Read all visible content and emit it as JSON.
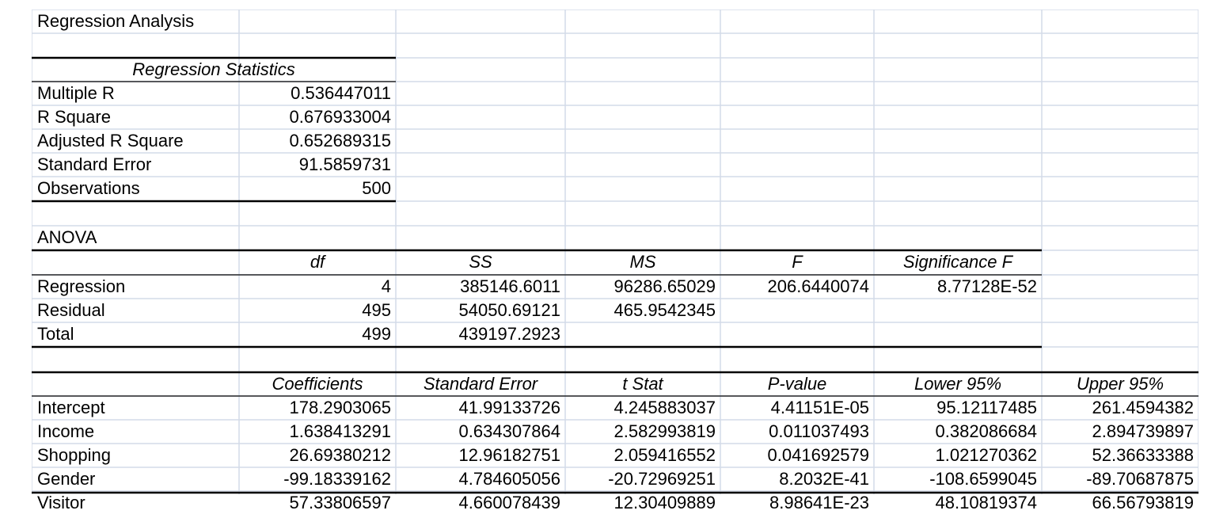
{
  "title": "Regression Analysis",
  "regression_statistics": {
    "header": "Regression Statistics",
    "rows": [
      {
        "label": "Multiple R",
        "value": "0.536447011"
      },
      {
        "label": "R Square",
        "value": "0.676933004"
      },
      {
        "label": "Adjusted R Square",
        "value": "0.652689315"
      },
      {
        "label": "Standard Error",
        "value": "91.5859731"
      },
      {
        "label": "Observations",
        "value": "500"
      }
    ]
  },
  "anova": {
    "title": "ANOVA",
    "headers": [
      "df",
      "SS",
      "MS",
      "F",
      "Significance F"
    ],
    "rows": [
      {
        "label": "Regression",
        "df": "4",
        "ss": "385146.6011",
        "ms": "96286.65029",
        "f": "206.6440074",
        "sig": "8.77128E-52"
      },
      {
        "label": "Residual",
        "df": "495",
        "ss": "54050.69121",
        "ms": "465.9542345"
      },
      {
        "label": "Total",
        "df": "499",
        "ss": "439197.2923"
      }
    ]
  },
  "coefficients": {
    "headers": [
      "Coefficients",
      "Standard Error",
      "t Stat",
      "P-value",
      "Lower 95%",
      "Upper 95%"
    ],
    "rows": [
      {
        "label": "Intercept",
        "coef": "178.2903065",
        "se": "41.99133726",
        "t": "4.245883037",
        "p": "4.41151E-05",
        "lower": "95.12117485",
        "upper": "261.4594382"
      },
      {
        "label": "Income",
        "coef": "1.638413291",
        "se": "0.634307864",
        "t": "2.582993819",
        "p": "0.011037493",
        "lower": "0.382086684",
        "upper": "2.894739897"
      },
      {
        "label": "Shopping",
        "coef": "26.69380212",
        "se": "12.96182751",
        "t": "2.059416552",
        "p": "0.041692579",
        "lower": "1.021270362",
        "upper": "52.36633388"
      },
      {
        "label": "Gender",
        "coef": "-99.18339162",
        "se": "4.784605056",
        "t": "-20.72969251",
        "p": "8.2032E-41",
        "lower": "-108.6599045",
        "upper": "-89.70687875"
      },
      {
        "label": "Visitor",
        "coef": "57.33806597",
        "se": "4.660078439",
        "t": "12.30409889",
        "p": "8.98641E-23",
        "lower": "48.10819374",
        "upper": "66.56793819"
      }
    ]
  }
}
